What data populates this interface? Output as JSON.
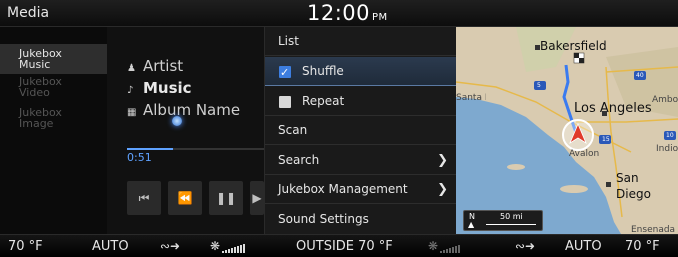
{
  "header": {
    "title": "Media",
    "time": "12:00",
    "ampm": "PM"
  },
  "sidebar": {
    "items": [
      {
        "line1": "Jukebox",
        "line2": "Music",
        "active": true
      },
      {
        "line1": "Jukebox",
        "line2": "Video",
        "active": false
      },
      {
        "line1": "Jukebox",
        "line2": "Image",
        "active": false
      }
    ]
  },
  "player": {
    "artist": "Artist",
    "title": "Music",
    "album": "Album Name",
    "elapsed": "0:51",
    "progress": 0.33,
    "controls": [
      "skip-back",
      "rewind",
      "pause",
      "fast-forward"
    ]
  },
  "menu": {
    "items": [
      {
        "label": "List"
      },
      {
        "label": "Shuffle",
        "checkbox": true,
        "checked": true,
        "selected": true
      },
      {
        "label": "Repeat",
        "checkbox": true,
        "checked": false
      },
      {
        "label": "Scan"
      },
      {
        "label": "Search",
        "submenu": true
      },
      {
        "label": "Jukebox Management",
        "submenu": true
      },
      {
        "label": "Sound Settings"
      }
    ]
  },
  "map": {
    "places": [
      "Bakersfield",
      "Santa Barbara",
      "Los Angeles",
      "Avalon",
      "San Diego",
      "Ensenada",
      "Indio",
      "Amboy"
    ],
    "routes": [
      "5",
      "40",
      "15",
      "10"
    ],
    "scale": {
      "north": "N",
      "distance": "50 mi"
    },
    "colors": {
      "water": "#7ea9cf",
      "land": "#d9cbb0",
      "route": "#3a7bf0"
    }
  },
  "climate": {
    "left_temp": "70 °F",
    "left_mode": "AUTO",
    "outside": "OUTSIDE  70 °F",
    "right_mode": "AUTO",
    "right_temp": "70 °F"
  }
}
